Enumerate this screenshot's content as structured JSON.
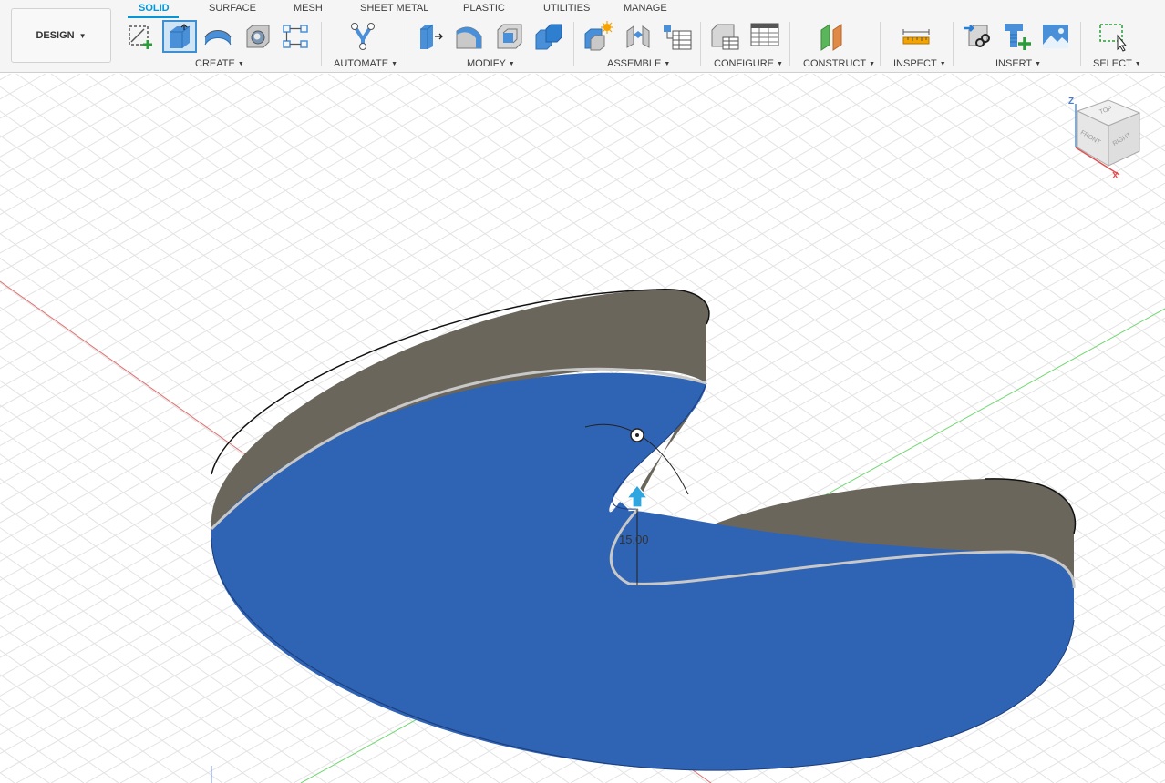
{
  "toolbar": {
    "workspace_button": "DESIGN",
    "tabs": [
      {
        "label": "SOLID",
        "active": true
      },
      {
        "label": "SURFACE"
      },
      {
        "label": "MESH"
      },
      {
        "label": "SHEET METAL"
      },
      {
        "label": "PLASTIC"
      },
      {
        "label": "UTILITIES"
      },
      {
        "label": "MANAGE"
      }
    ],
    "groups": [
      {
        "label": "CREATE",
        "tools": [
          "create-sketch-icon",
          "extrude-icon",
          "revolve-icon",
          "hole-icon",
          "pattern-icon"
        ]
      },
      {
        "label": "AUTOMATE",
        "tools": [
          "automate-icon"
        ]
      },
      {
        "label": "MODIFY",
        "tools": [
          "press-pull-icon",
          "fillet-icon",
          "shell-icon",
          "combine-icon"
        ]
      },
      {
        "label": "ASSEMBLE",
        "tools": [
          "new-component-icon",
          "joint-icon",
          "bom-icon"
        ]
      },
      {
        "label": "CONFIGURE",
        "tools": [
          "configure-icon",
          "configuration-table-icon"
        ]
      },
      {
        "label": "CONSTRUCT",
        "tools": [
          "plane-icon"
        ]
      },
      {
        "label": "INSPECT",
        "tools": [
          "measure-icon"
        ]
      },
      {
        "label": "INSERT",
        "tools": [
          "insert-derive-icon",
          "insert-mcmaster-icon",
          "insert-image-icon"
        ]
      },
      {
        "label": "SELECT",
        "tools": [
          "window-select-icon"
        ]
      }
    ]
  },
  "viewport": {
    "dimension_value": "15.00",
    "viewcube": {
      "top": "TOP",
      "front": "FRONT",
      "right": "RIGHT",
      "axis_z": "Z",
      "axis_x": "X"
    }
  },
  "colors": {
    "accent": "#0696d7",
    "face_selected": "#2f63b4",
    "wall": "#6b665c",
    "grid": "#e3e3e3",
    "axis_red": "#e05050",
    "axis_green": "#50d050"
  }
}
